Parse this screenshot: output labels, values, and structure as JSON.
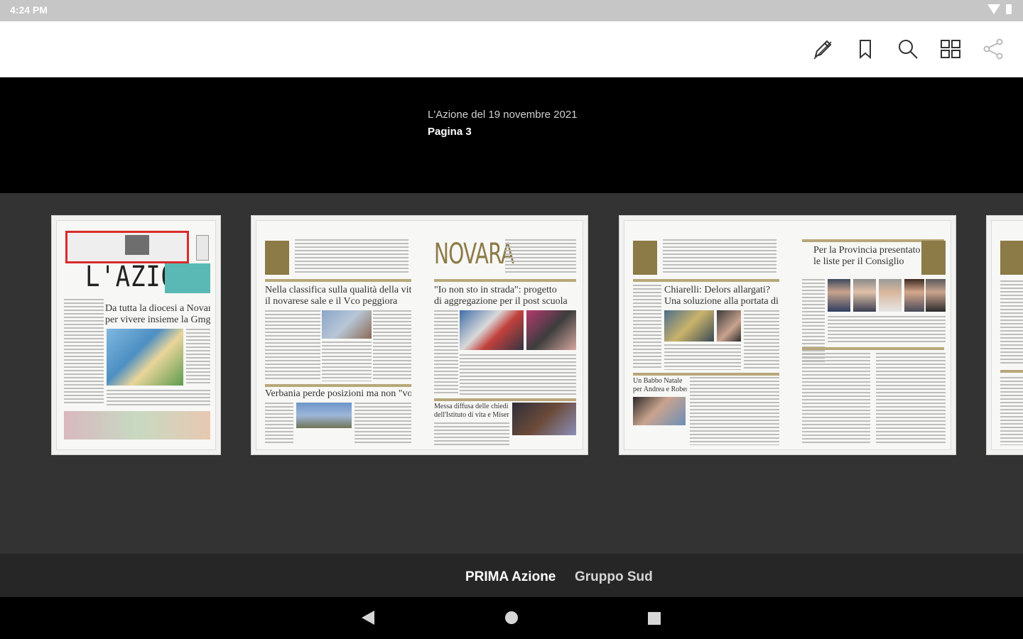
{
  "status_bar": {
    "time": "4:24 PM"
  },
  "toolbar": {
    "icons": [
      "edit-icon",
      "bookmark-icon",
      "search-icon",
      "grid-view-icon",
      "share-icon"
    ]
  },
  "banner": {
    "issue_title": "L'Azione del 19 novembre 2021",
    "page_label": "Pagina 3"
  },
  "pages": [
    {
      "headline_1": "Da tutta la diocesi a Novara",
      "headline_2": "per vivere insieme la Gmg"
    },
    {
      "left_headline_1": "Nella classifica sulla qualità della vita",
      "left_headline_2": "il novarese sale e il Vco peggiora",
      "left_bottom_headline": "Verbania perde posizioni ma non \"vorde\"",
      "right_headline_1": "\"Io non sto in strada\": progetto",
      "right_headline_2": "di aggregazione per il post scuola",
      "right_bottom_headline_1": "Messa diffusa delle chiedi diocesi",
      "right_bottom_headline_2": "dell'Istituto di vita e Misericordia"
    },
    {
      "left_headline_1": "Chiarelli: Delors allargati?",
      "left_headline_2": "Una soluzione alla portata di tutti",
      "left_bottom_headline_1": "Un Babbo Natale",
      "left_bottom_headline_2": "per Andrea e Roberto",
      "right_headline_1": "Per la Provincia presentato",
      "right_headline_2": "le liste per il Consiglio"
    }
  ],
  "categories": [
    {
      "label": "PRIMA Azione",
      "active": true
    },
    {
      "label": "Gruppo Sud",
      "active": false
    }
  ],
  "colors": {
    "accent_gold": "#8c7a47",
    "banner_bg": "#000000",
    "strip_bg": "#333333",
    "category_bg": "#262626"
  }
}
